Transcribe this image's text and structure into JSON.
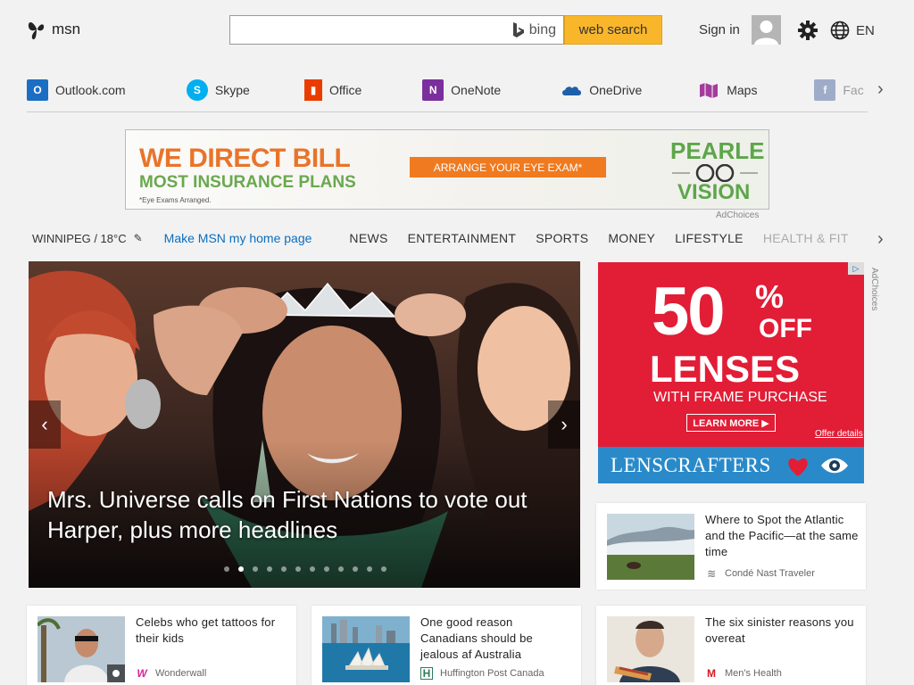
{
  "header": {
    "logo_text": "msn",
    "bing_label": "bing",
    "search_button": "web search",
    "search_value": "",
    "signin": "Sign in",
    "lang": "EN"
  },
  "apps": [
    {
      "label": "Outlook.com",
      "icon": "outlook-icon",
      "color": "#1b6ec2"
    },
    {
      "label": "Skype",
      "icon": "skype-icon",
      "color": "#00aff0"
    },
    {
      "label": "Office",
      "icon": "office-icon",
      "color": "#eb3c00"
    },
    {
      "label": "OneNote",
      "icon": "onenote-icon",
      "color": "#7b2f9d"
    },
    {
      "label": "OneDrive",
      "icon": "onedrive-icon",
      "color": "#1e5fa8"
    },
    {
      "label": "Maps",
      "icon": "maps-icon",
      "color": "#a33c9c"
    },
    {
      "label": "Fac",
      "icon": "facebook-icon",
      "color": "#3b5998"
    }
  ],
  "top_ad": {
    "line1": "WE DIRECT BILL",
    "line2": "MOST INSURANCE PLANS",
    "note": "*Eye Exams Arranged.",
    "button": "ARRANGE YOUR EYE EXAM*",
    "brand1": "PEARLE",
    "brand2": "VISION",
    "adchoices": "AdChoices"
  },
  "nav": {
    "weather": "WINNIPEG / 18°C",
    "make_home": "Make MSN my home page",
    "categories": [
      "NEWS",
      "ENTERTAINMENT",
      "SPORTS",
      "MONEY",
      "LIFESTYLE",
      "HEALTH & FIT"
    ]
  },
  "hero": {
    "caption": "Mrs. Universe calls on First Nations to vote out Harper, plus more headlines",
    "slide_count": 12,
    "active_slide": 2
  },
  "right_ad": {
    "big": "50",
    "pct": "%",
    "off": "OFF",
    "lenses": "LENSES",
    "with": "WITH FRAME PURCHASE",
    "button": "LEARN MORE ▶",
    "offer": "Offer details",
    "brand": "LENSCRAFTERS",
    "adchoices": "AdChoices"
  },
  "cards": [
    {
      "title": "Where to Spot the Atlantic and the Pacific—at the same time",
      "source": "Condé Nast Traveler",
      "source_mark": "≋",
      "source_color": "#888"
    },
    {
      "title": "Celebs who get tattoos for their kids",
      "source": "Wonderwall",
      "source_mark": "W",
      "source_color": "#d6269a"
    },
    {
      "title": "One good reason Canadians should be jealous af Australia",
      "source": "Huffington Post Canada",
      "source_mark": "H",
      "source_color": "#2e7d5b"
    },
    {
      "title": "The six sinister reasons you overeat",
      "source": "Men's Health",
      "source_mark": "M",
      "source_color": "#d41b24"
    }
  ]
}
